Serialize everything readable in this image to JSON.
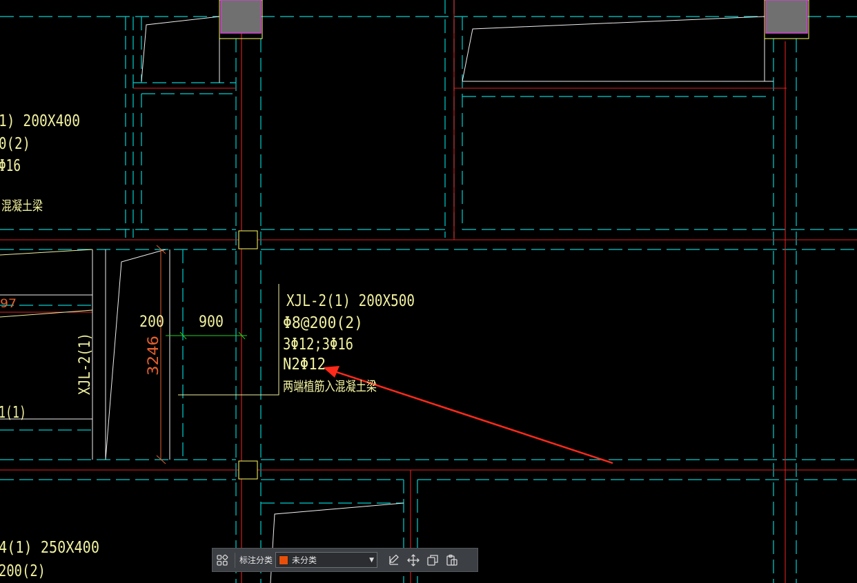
{
  "drawing": {
    "beam_top_left": [
      "1) 200X400",
      "0(2)",
      "Φ16",
      "混凝土梁"
    ],
    "beam_main": [
      "XJL-2(1) 200X500",
      "Φ8@200(2)",
      "3Φ12;3Φ16",
      "N2Φ12",
      "两端植筋入混凝土梁"
    ],
    "beam_bottom_left": [
      "4(1) 250X400",
      "200(2)"
    ],
    "left_vertical_label": "XJL-2(1)",
    "left_partial_label": "1(1)",
    "left_red_label": "97",
    "dim_200": "200",
    "dim_900": "900",
    "dim_3246": "3246",
    "colors": {
      "background": "#000000",
      "grid_red": "#e02020",
      "axis_cyan": "#00d0d0",
      "outline_white": "#f0f0f0",
      "text_yellow": "#f2f2a0",
      "dim_orange": "#e4602c",
      "dim_green": "#20d020",
      "arrow_red": "#ff2a1a",
      "column_fill": "#707070",
      "column_border": "#ffff66"
    }
  },
  "toolbar": {
    "label": "标注分类",
    "select_value": "未分类",
    "swatch_color": "#e8500a"
  }
}
